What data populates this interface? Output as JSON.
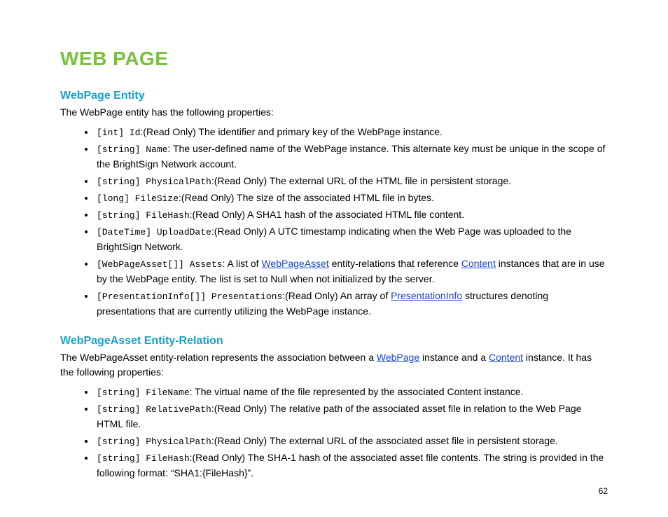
{
  "title": "WEB PAGE",
  "page_number": "62",
  "section1": {
    "heading": "WebPage Entity",
    "intro": "The WebPage entity has the following properties:",
    "items": {
      "i0": {
        "code": "[int] Id",
        "desc": ":(Read Only) The identifier and primary key of the WebPage instance."
      },
      "i1": {
        "code": "[string] Name",
        "desc": ": The user-defined name of the WebPage instance. This alternate key must be unique in the scope of the BrightSign Network account."
      },
      "i2": {
        "code": "[string] PhysicalPath",
        "desc": ":(Read Only) The external URL of the HTML file in persistent storage."
      },
      "i3": {
        "code": "[long] FileSize",
        "desc": ":(Read Only) The size of the associated HTML file in bytes."
      },
      "i4": {
        "code": "[string] FileHash",
        "desc": ":(Read Only) A SHA1 hash of the associated HTML file content."
      },
      "i5": {
        "code": "[DateTime] UploadDate",
        "desc": ":(Read Only) A UTC timestamp indicating when the Web Page was uploaded to the BrightSign Network."
      },
      "i6": {
        "code": "[WebPageAsset[]] Assets",
        "pre": ": A list of ",
        "link1": "WebPageAsset",
        "mid": " entity-relations that reference ",
        "link2": "Content",
        "post": " instances that are in use by the WebPage entity. The list is set to Null when not initialized by the server."
      },
      "i7": {
        "code": "[PresentationInfo[]] Presentations",
        "pre": ":(Read Only) An array of ",
        "link1": "PresentationInfo",
        "post": " structures denoting presentations that are currently utilizing the WebPage instance."
      }
    }
  },
  "section2": {
    "heading": "WebPageAsset Entity-Relation",
    "intro_pre": "The WebPageAsset entity-relation represents the association between a ",
    "intro_link1": "WebPage",
    "intro_mid": " instance and a ",
    "intro_link2": "Content",
    "intro_post": " instance. It has the following properties:",
    "items": {
      "i0": {
        "code": "[string] FileName",
        "desc": ": The virtual name of the file represented by the associated Content instance."
      },
      "i1": {
        "code": "[string] RelativePath",
        "desc": ":(Read Only) The relative path of the associated asset file in relation to the Web Page HTML file."
      },
      "i2": {
        "code": "[string] PhysicalPath",
        "desc": ":(Read Only) The external URL of the associated asset file in persistent storage."
      },
      "i3": {
        "code": "[string] FileHash",
        "desc": ":(Read Only) The SHA-1 hash of the associated asset file contents. The string is provided in the following format: “SHA1:{FileHash}”."
      }
    }
  }
}
